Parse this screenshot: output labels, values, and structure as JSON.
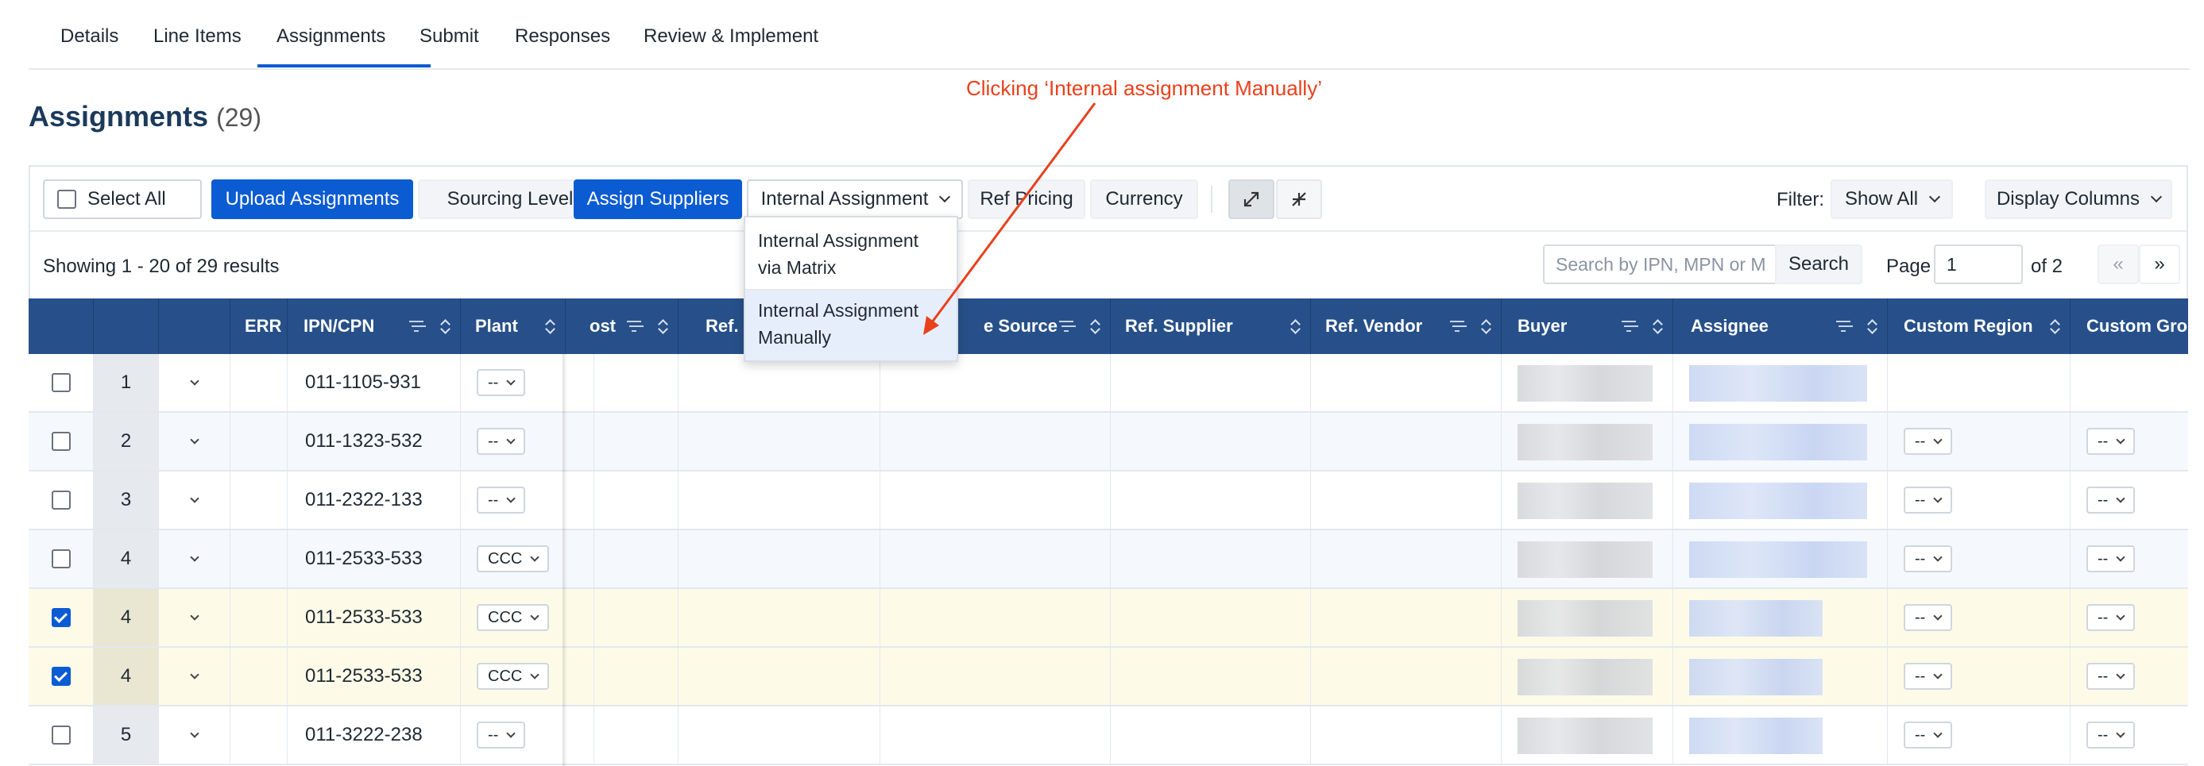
{
  "tabs": [
    {
      "label": "Details"
    },
    {
      "label": "Line Items"
    },
    {
      "label": "Assignments",
      "active": true
    },
    {
      "label": "Submit"
    },
    {
      "label": "Responses"
    },
    {
      "label": "Review & Implement"
    }
  ],
  "page": {
    "title": "Assignments",
    "count": "(29)"
  },
  "toolbar": {
    "select_all": "Select All",
    "upload": "Upload Assignments",
    "sourcing_level": "Sourcing Level",
    "assign_suppliers": "Assign Suppliers",
    "internal_assignment": "Internal Assignment",
    "ref_pricing": "Ref Pricing",
    "currency": "Currency",
    "filter_label": "Filter:",
    "filter_value": "Show All",
    "display_columns": "Display Columns"
  },
  "dropdown": {
    "items": [
      {
        "line1": "Internal Assignment",
        "line2": "via Matrix"
      },
      {
        "line1": "Internal Assignment",
        "line2": "Manually"
      }
    ]
  },
  "results": {
    "showing": "Showing 1 - 20 of 29 results",
    "search_placeholder": "Search by IPN, MPN or M",
    "search_button": "Search",
    "page_label": "Page",
    "page_value": "1",
    "of_pages": "of 2",
    "prev": "«",
    "next": "»"
  },
  "columns": {
    "err": "ERR",
    "ipn": "IPN/CPN",
    "plant": "Plant",
    "cost": "ost",
    "ref_qu": "Ref. Qu",
    "source": "e Source",
    "ref_supplier": "Ref. Supplier",
    "ref_vendor": "Ref. Vendor",
    "buyer": "Buyer",
    "assignee": "Assignee",
    "custom_region": "Custom Region",
    "custom_group": "Custom Group"
  },
  "rows": [
    {
      "num": "1",
      "ipn": "011-1105-931",
      "plant": "--",
      "region": "",
      "group": "",
      "checked": false
    },
    {
      "num": "2",
      "ipn": "011-1323-532",
      "plant": "--",
      "region": "--",
      "group": "--",
      "checked": false
    },
    {
      "num": "3",
      "ipn": "011-2322-133",
      "plant": "--",
      "region": "--",
      "group": "--",
      "checked": false
    },
    {
      "num": "4",
      "ipn": "011-2533-533",
      "plant": "CCC",
      "region": "--",
      "group": "--",
      "checked": false
    },
    {
      "num": "4",
      "ipn": "011-2533-533",
      "plant": "CCC",
      "region": "--",
      "group": "--",
      "checked": true
    },
    {
      "num": "4",
      "ipn": "011-2533-533",
      "plant": "CCC",
      "region": "--",
      "group": "--",
      "checked": true
    },
    {
      "num": "5",
      "ipn": "011-3222-238",
      "plant": "--",
      "region": "--",
      "group": "--",
      "checked": false
    }
  ],
  "annotation": "Clicking ‘Internal assignment Manually’",
  "colors": {
    "primary": "#0b5bd3",
    "header": "#27508a",
    "annotation": "#e8411c",
    "selected_row": "#fdfbe8",
    "alt_row": "#f5f8fd"
  },
  "icons": [
    "expand-icon",
    "collapse-icon",
    "chevron-down-icon",
    "filter-icon",
    "sort-icon",
    "row-expand-chevron-icon"
  ]
}
